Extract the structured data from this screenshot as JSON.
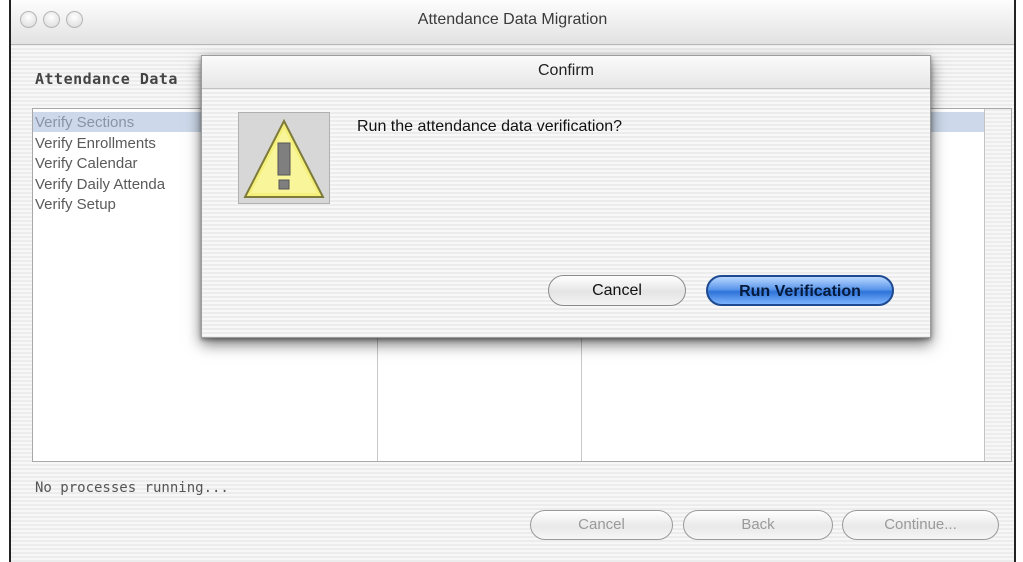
{
  "window": {
    "title": "Attendance Data Migration",
    "heading": "Attendance Data",
    "steps": [
      {
        "label": "Verify Sections",
        "selected": true
      },
      {
        "label": "Verify Enrollments",
        "selected": false
      },
      {
        "label": "Verify Calendar",
        "selected": false
      },
      {
        "label": "Verify Daily Attenda",
        "selected": false
      },
      {
        "label": "Verify Setup",
        "selected": false
      }
    ],
    "status": "No processes running...",
    "buttons": {
      "cancel": "Cancel",
      "back": "Back",
      "continue": "Continue..."
    }
  },
  "dialog": {
    "title": "Confirm",
    "message": "Run the attendance data verification?",
    "icon": "warning-icon",
    "buttons": {
      "cancel": "Cancel",
      "run": "Run Verification"
    }
  },
  "colors": {
    "default_button": "#2f73d8",
    "selection": "#cdd9ea",
    "warning_fill": "#f5f07a"
  }
}
